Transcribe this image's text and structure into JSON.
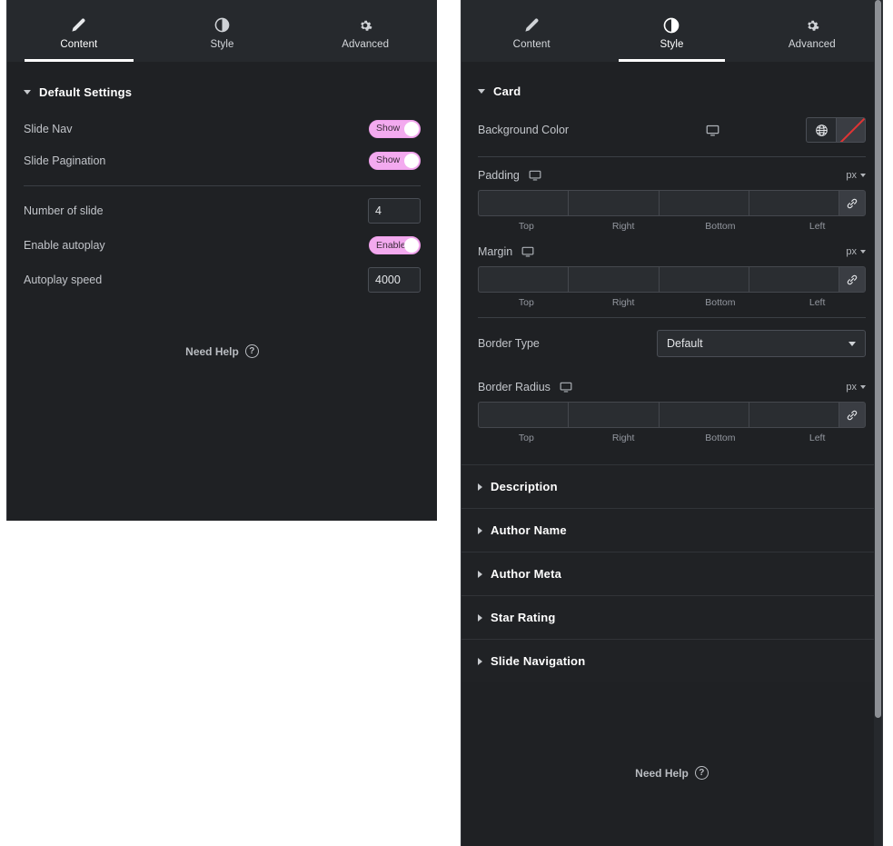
{
  "tabs": [
    {
      "label": "Content",
      "icon": "pencil-icon",
      "active_left": true,
      "active_right": false
    },
    {
      "label": "Style",
      "icon": "contrast-icon",
      "active_left": false,
      "active_right": true
    },
    {
      "label": "Advanced",
      "icon": "gear-icon",
      "active_left": false,
      "active_right": false
    }
  ],
  "left_panel": {
    "section": {
      "title": "Default Settings",
      "state": "expanded"
    },
    "controls": {
      "slide_nav": {
        "label": "Slide Nav",
        "toggle_text": "Show",
        "state": "on"
      },
      "slide_pagination": {
        "label": "Slide Pagination",
        "toggle_text": "Show",
        "state": "on"
      },
      "number_of_slide": {
        "label": "Number of slide",
        "value": "4",
        "placeholder": ""
      },
      "enable_autoplay": {
        "label": "Enable autoplay",
        "toggle_text": "Enable",
        "state": "on"
      },
      "autoplay_speed": {
        "label": "Autoplay speed",
        "value": "4000",
        "placeholder": ""
      }
    },
    "need_help": {
      "label": "Need Help",
      "icon": "question-circle-icon"
    }
  },
  "right_panel": {
    "section": {
      "title": "Card",
      "state": "expanded"
    },
    "background_color": {
      "label": "Background Color",
      "device_icon": "monitor-icon",
      "global_icon": "globe-icon",
      "swatch": "transparent"
    },
    "padding": {
      "label": "Padding",
      "device_icon": "monitor-icon",
      "unit": "px",
      "values": [
        "",
        "",
        "",
        ""
      ],
      "side_labels": [
        "Top",
        "Right",
        "Bottom",
        "Left"
      ],
      "link_icon": "link-icon"
    },
    "margin": {
      "label": "Margin",
      "device_icon": "monitor-icon",
      "unit": "px",
      "values": [
        "",
        "",
        "",
        ""
      ],
      "side_labels": [
        "Top",
        "Right",
        "Bottom",
        "Left"
      ],
      "link_icon": "link-icon"
    },
    "border_type": {
      "label": "Border Type",
      "value": "Default"
    },
    "border_radius": {
      "label": "Border Radius",
      "device_icon": "monitor-icon",
      "unit": "px",
      "values": [
        "",
        "",
        "",
        ""
      ],
      "side_labels": [
        "Top",
        "Right",
        "Bottom",
        "Left"
      ],
      "link_icon": "link-icon"
    },
    "accordions": [
      {
        "title": "Description",
        "state": "collapsed"
      },
      {
        "title": "Author Name",
        "state": "collapsed"
      },
      {
        "title": "Author Meta",
        "state": "collapsed"
      },
      {
        "title": "Star Rating",
        "state": "collapsed"
      },
      {
        "title": "Slide Navigation",
        "state": "collapsed"
      }
    ],
    "need_help": {
      "label": "Need Help",
      "icon": "question-circle-icon"
    }
  },
  "colors": {
    "panel_bg": "#1f2124",
    "tabbar_bg": "#26292d",
    "accent_toggle": "#f3aaef",
    "active_tab_underline": "#ffffff",
    "swatch_slash": "#e03434"
  }
}
